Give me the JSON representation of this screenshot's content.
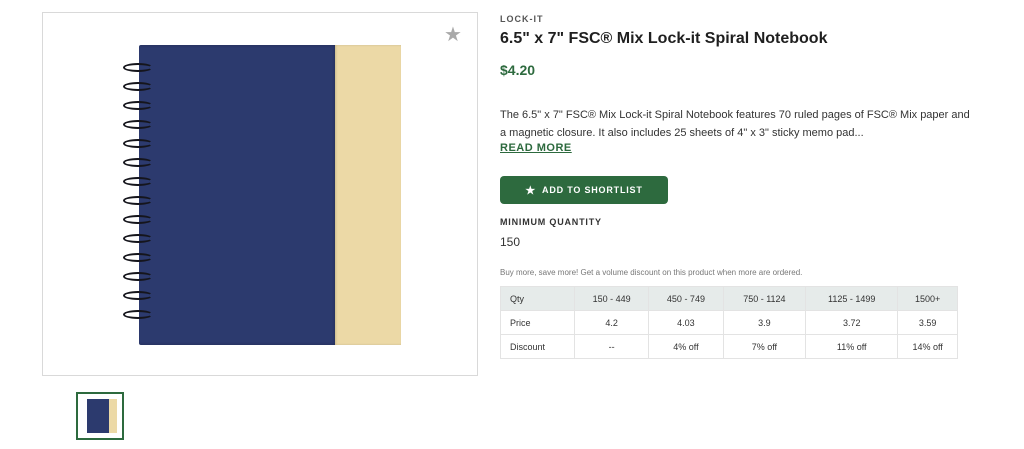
{
  "gallery": {
    "favorite_icon": "star-icon",
    "main_image_alt": "6.5\" x 7\" FSC® Mix Lock-it Spiral Notebook",
    "colors": {
      "cover": "#2c3a6e",
      "flap": "#ecd9a6",
      "spiral": "#15151c"
    }
  },
  "product": {
    "brand": "LOCK-IT",
    "title": "6.5\" x 7\" FSC® Mix Lock-it Spiral Notebook",
    "price": "$4.20",
    "description": "The 6.5\" x 7\" FSC® Mix Lock-it Spiral Notebook features 70 ruled pages of FSC® Mix paper and a magnetic closure. It also includes 25 sheets of 4\" x 3\" sticky memo pad...",
    "read_more": "READ MORE"
  },
  "actions": {
    "shortlist_label": "ADD TO SHORTLIST",
    "shortlist_icon": "star-icon"
  },
  "minimum": {
    "label": "MINIMUM QUANTITY",
    "value": "150"
  },
  "volume_note": "Buy more, save more! Get a volume discount on this product when more are ordered.",
  "pricing_table": {
    "headers": [
      "Qty",
      "150 - 449",
      "450 - 749",
      "750 - 1124",
      "1125 - 1499",
      "1500+"
    ],
    "rows": [
      [
        "Price",
        "4.2",
        "4.03",
        "3.9",
        "3.72",
        "3.59"
      ],
      [
        "Discount",
        "--",
        "4% off",
        "7% off",
        "11% off",
        "14% off"
      ]
    ]
  },
  "colors": {
    "accent": "#2d6a3e",
    "table_header_bg": "#e6ebea"
  }
}
